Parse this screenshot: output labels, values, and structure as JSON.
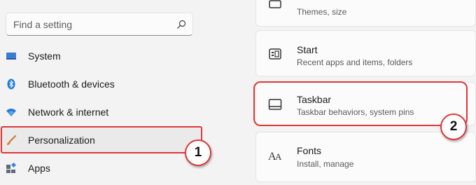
{
  "search": {
    "placeholder": "Find a setting"
  },
  "nav": [
    {
      "label": "System",
      "icon": "monitor-icon"
    },
    {
      "label": "Bluetooth & devices",
      "icon": "bluetooth-icon"
    },
    {
      "label": "Network & internet",
      "icon": "wifi-icon"
    },
    {
      "label": "Personalization",
      "icon": "brush-icon",
      "selected": true
    },
    {
      "label": "Apps",
      "icon": "apps-icon"
    }
  ],
  "cards": [
    {
      "title": "",
      "subtitle": "Themes, size"
    },
    {
      "title": "Start",
      "subtitle": "Recent apps and items, folders"
    },
    {
      "title": "Taskbar",
      "subtitle": "Taskbar behaviors, system pins"
    },
    {
      "title": "Fonts",
      "subtitle": "Install, manage"
    }
  ],
  "annotations": {
    "one": "1",
    "two": "2"
  },
  "colors": {
    "accent": "#0067c0",
    "annotation_red": "#e03838"
  }
}
